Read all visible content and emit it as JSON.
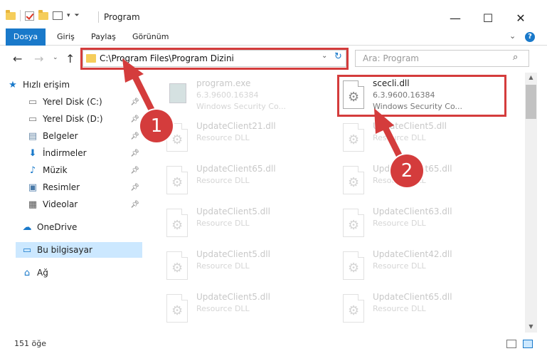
{
  "window": {
    "title": "Program",
    "controls": {
      "minimize": "—",
      "maximize": "☐",
      "close": "✕"
    }
  },
  "ribbon": {
    "tabs": [
      "Dosya",
      "Giriş",
      "Paylaş",
      "Görünüm"
    ],
    "help": "?"
  },
  "address": {
    "path": "C:\\Program Files\\Program Dizini",
    "dropdown": "⌄",
    "refresh": "↻"
  },
  "search": {
    "placeholder": "Ara: Program",
    "icon": "search-icon"
  },
  "nav": {
    "items": [
      {
        "label": "Hızlı erişim",
        "icon": "star-icon",
        "pinned": false
      },
      {
        "label": "Yerel Disk (C:)",
        "icon": "drive-icon",
        "pinned": true
      },
      {
        "label": "Yerel Disk (D:)",
        "icon": "drive-icon",
        "pinned": true
      },
      {
        "label": "Belgeler",
        "icon": "documents-icon",
        "pinned": true
      },
      {
        "label": "İndirmeler",
        "icon": "downloads-icon",
        "pinned": true
      },
      {
        "label": "Müzik",
        "icon": "music-icon",
        "pinned": true
      },
      {
        "label": "Resimler",
        "icon": "pictures-icon",
        "pinned": true
      },
      {
        "label": "Videolar",
        "icon": "videos-icon",
        "pinned": true
      },
      {
        "label": "OneDrive",
        "icon": "cloud-icon",
        "pinned": false
      },
      {
        "label": "Bu bilgisayar",
        "icon": "computer-icon",
        "pinned": false,
        "selected": true
      },
      {
        "label": "Ağ",
        "icon": "network-icon",
        "pinned": false
      }
    ]
  },
  "files": [
    {
      "name": "program.exe",
      "line1": "6.3.9600.16384",
      "line2": "Windows Security Co...",
      "highlight": false
    },
    {
      "name": "scecli.dll",
      "line1": "6.3.9600.16384",
      "line2": "Windows Security Co...",
      "highlight": true
    },
    {
      "name": "UpdateClient21.dll",
      "line1": "Resource DLL",
      "highlight": false
    },
    {
      "name": "UpdateClient5.dll",
      "line1": "Resource DLL",
      "highlight": false
    },
    {
      "name": "UpdateClient65.dll",
      "line1": "Resource DLL",
      "highlight": false
    },
    {
      "name": "UpdateClient65.dll",
      "line1": "Resource DLL",
      "highlight": false
    },
    {
      "name": "UpdateClient5.dll",
      "line1": "Resource DLL",
      "highlight": false
    },
    {
      "name": "UpdateClient63.dll",
      "line1": "Resource DLL",
      "highlight": false
    },
    {
      "name": "UpdateClient5.dll",
      "line1": "Resource DLL",
      "highlight": false
    },
    {
      "name": "UpdateClient42.dll",
      "line1": "Resource DLL",
      "highlight": false
    },
    {
      "name": "UpdateClient5.dll",
      "line1": "Resource DLL",
      "highlight": false
    },
    {
      "name": "UpdateClient65.dll",
      "line1": "Resource DLL",
      "highlight": false
    }
  ],
  "status": {
    "count": "151 öğe"
  },
  "callouts": {
    "one": "1",
    "two": "2"
  },
  "colors": {
    "accent": "#1979ca",
    "callout": "#d43c3c",
    "selection": "#cce8ff"
  }
}
